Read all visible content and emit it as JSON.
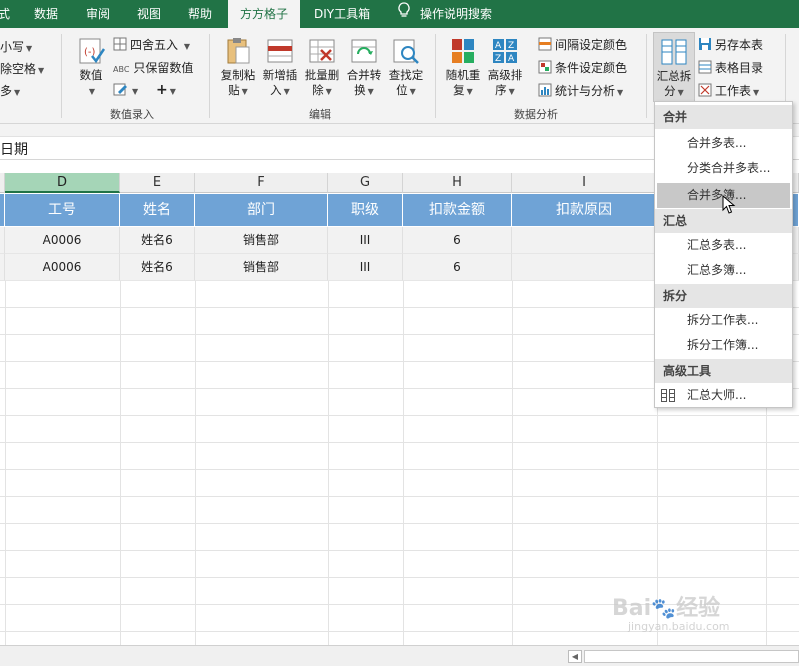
{
  "tabs": [
    "式",
    "数据",
    "审阅",
    "视图",
    "帮助",
    "方方格子",
    "DIY工具箱",
    "操作说明搜索"
  ],
  "ribbon": {
    "left_items": [
      "小写",
      "除空格",
      "多"
    ],
    "input_group": {
      "label": "数值录入",
      "value_btn": "数值",
      "round_btn": "四舍五入",
      "keep_btn": "只保留数值",
      "abc_badge": "ABC"
    },
    "edit_group": {
      "label": "编辑",
      "buttons": [
        [
          "复制粘",
          "贴"
        ],
        [
          "新增插",
          "入"
        ],
        [
          "批量删",
          "除"
        ],
        [
          "合并转",
          "换"
        ],
        [
          "查找定",
          "位"
        ]
      ]
    },
    "analysis_group": {
      "label": "数据分析",
      "buttons": [
        [
          "随机重",
          "复"
        ],
        [
          "高级排",
          "序"
        ]
      ],
      "sort_letters": [
        "A",
        "Z",
        "Z",
        "A"
      ],
      "list": [
        "间隔设定颜色",
        "条件设定颜色",
        "统计与分析"
      ]
    },
    "summary_group": {
      "button": [
        "汇总拆",
        "分"
      ],
      "list": [
        "另存本表",
        "表格目录",
        "工作表"
      ]
    }
  },
  "formula_text": "日期",
  "columns": [
    "D",
    "E",
    "F",
    "G",
    "H",
    "I"
  ],
  "table": {
    "headers": [
      "工号",
      "姓名",
      "部门",
      "职级",
      "扣款金额",
      "扣款原因"
    ],
    "rows": [
      [
        "A0006",
        "姓名6",
        "销售部",
        "III",
        "6",
        ""
      ],
      [
        "A0006",
        "姓名6",
        "销售部",
        "III",
        "6",
        ""
      ]
    ]
  },
  "dropdown": {
    "sections": [
      {
        "title": "合并",
        "items": [
          "合并多表...",
          "分类合并多表...",
          "合并多簿..."
        ]
      },
      {
        "title": "汇总",
        "items": [
          "汇总多表...",
          "汇总多簿..."
        ]
      },
      {
        "title": "拆分",
        "items": [
          "拆分工作表...",
          "拆分工作簿..."
        ]
      },
      {
        "title": "高级工具",
        "items": [
          "汇总大师..."
        ]
      }
    ],
    "hovered": "合并多簿..."
  },
  "watermark": {
    "brand": "Bai",
    "brand_tail": "经验",
    "url": "jingyan.baidu.com"
  },
  "colors": {
    "excel_green": "#217346",
    "header_blue": "#6fa3d6",
    "selected_col": "#a5d5b7"
  }
}
